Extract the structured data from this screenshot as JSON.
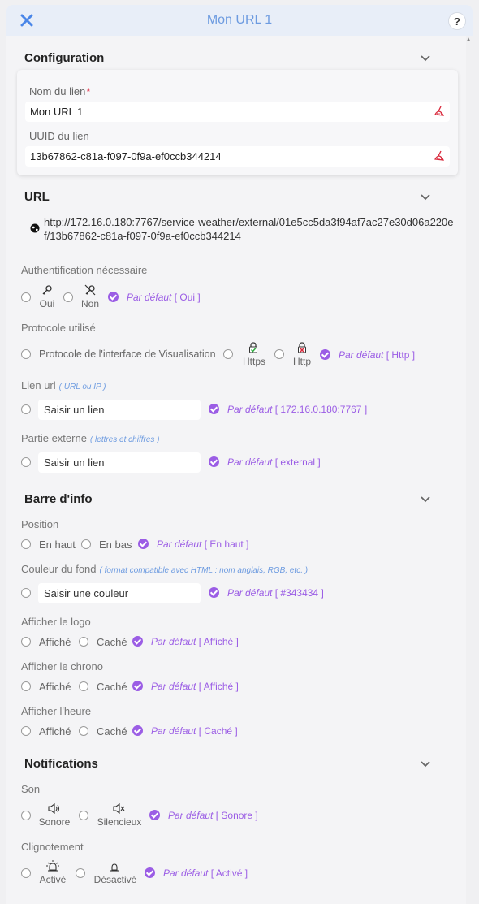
{
  "header": {
    "title": "Mon URL 1",
    "help": "?"
  },
  "sections": {
    "configuration": "Configuration",
    "url": "URL",
    "info_bar": "Barre d'info",
    "notifications": "Notifications"
  },
  "config": {
    "name_label": "Nom du lien",
    "required_mark": "*",
    "name_value": "Mon URL 1",
    "uuid_label": "UUID du lien",
    "uuid_value": "13b67862-c81a-f097-0f9a-ef0ccb344214"
  },
  "url_value": "http://172.16.0.180:7767/service-weather/external/01e5cc5da3f94af7ac27e30d06a220ef/13b67862-c81a-f097-0f9a-ef0ccb344214",
  "auth": {
    "label": "Authentification nécessaire",
    "yes": "Oui",
    "no": "Non",
    "default_text": "Par défaut",
    "default_value": "[ Oui ]"
  },
  "protocol": {
    "label": "Protocole utilisé",
    "option_interface": "Protocole de l'interface de Visualisation",
    "https": "Https",
    "http": "Http",
    "default_text": "Par défaut",
    "default_value": "[ Http ]"
  },
  "link": {
    "label": "Lien url",
    "hint": "( URL ou IP )",
    "placeholder": "Saisir un lien",
    "default_text": "Par défaut",
    "default_value": "[ 172.16.0.180:7767 ]"
  },
  "external": {
    "label": "Partie externe",
    "hint": "( lettres et chiffres )",
    "placeholder": "Saisir un lien",
    "default_text": "Par défaut",
    "default_value": "[ external ]"
  },
  "position": {
    "label": "Position",
    "top": "En haut",
    "bottom": "En bas",
    "default_text": "Par défaut",
    "default_value": "[ En haut ]"
  },
  "bgcolor": {
    "label": "Couleur du fond",
    "hint": "( format compatible avec HTML : nom anglais, RGB, etc. )",
    "placeholder": "Saisir une couleur",
    "default_text": "Par défaut",
    "default_value": "[ #343434 ]"
  },
  "logo": {
    "label": "Afficher le logo",
    "shown": "Affiché",
    "hidden": "Caché",
    "default_text": "Par défaut",
    "default_value": "[ Affiché ]"
  },
  "chrono": {
    "label": "Afficher le chrono",
    "shown": "Affiché",
    "hidden": "Caché",
    "default_text": "Par défaut",
    "default_value": "[ Affiché ]"
  },
  "hour": {
    "label": "Afficher l'heure",
    "shown": "Affiché",
    "hidden": "Caché",
    "default_text": "Par défaut",
    "default_value": "[ Caché ]"
  },
  "sound": {
    "label": "Son",
    "loud": "Sonore",
    "silent": "Silencieux",
    "default_text": "Par défaut",
    "default_value": "[ Sonore ]"
  },
  "blink": {
    "label": "Clignotement",
    "on": "Activé",
    "off": "Désactivé",
    "default_text": "Par défaut",
    "default_value": "[ Activé ]"
  },
  "colors": {
    "accent": "#9b5de5",
    "header_title": "#6d9be0",
    "hint": "#6d9be0",
    "required": "#e0233c"
  },
  "icons": {
    "close": "close-icon",
    "help": "help-icon",
    "chevron": "chevron-down-icon",
    "clear": "clear-brush-icon",
    "globe": "globe-icon",
    "key": "key-icon",
    "key_off": "key-off-icon",
    "lock_ok": "lock-check-icon",
    "lock_x": "lock-x-icon",
    "speaker": "speaker-icon",
    "mute": "speaker-mute-icon",
    "siren_on": "siren-on-icon",
    "siren_off": "siren-off-icon"
  }
}
